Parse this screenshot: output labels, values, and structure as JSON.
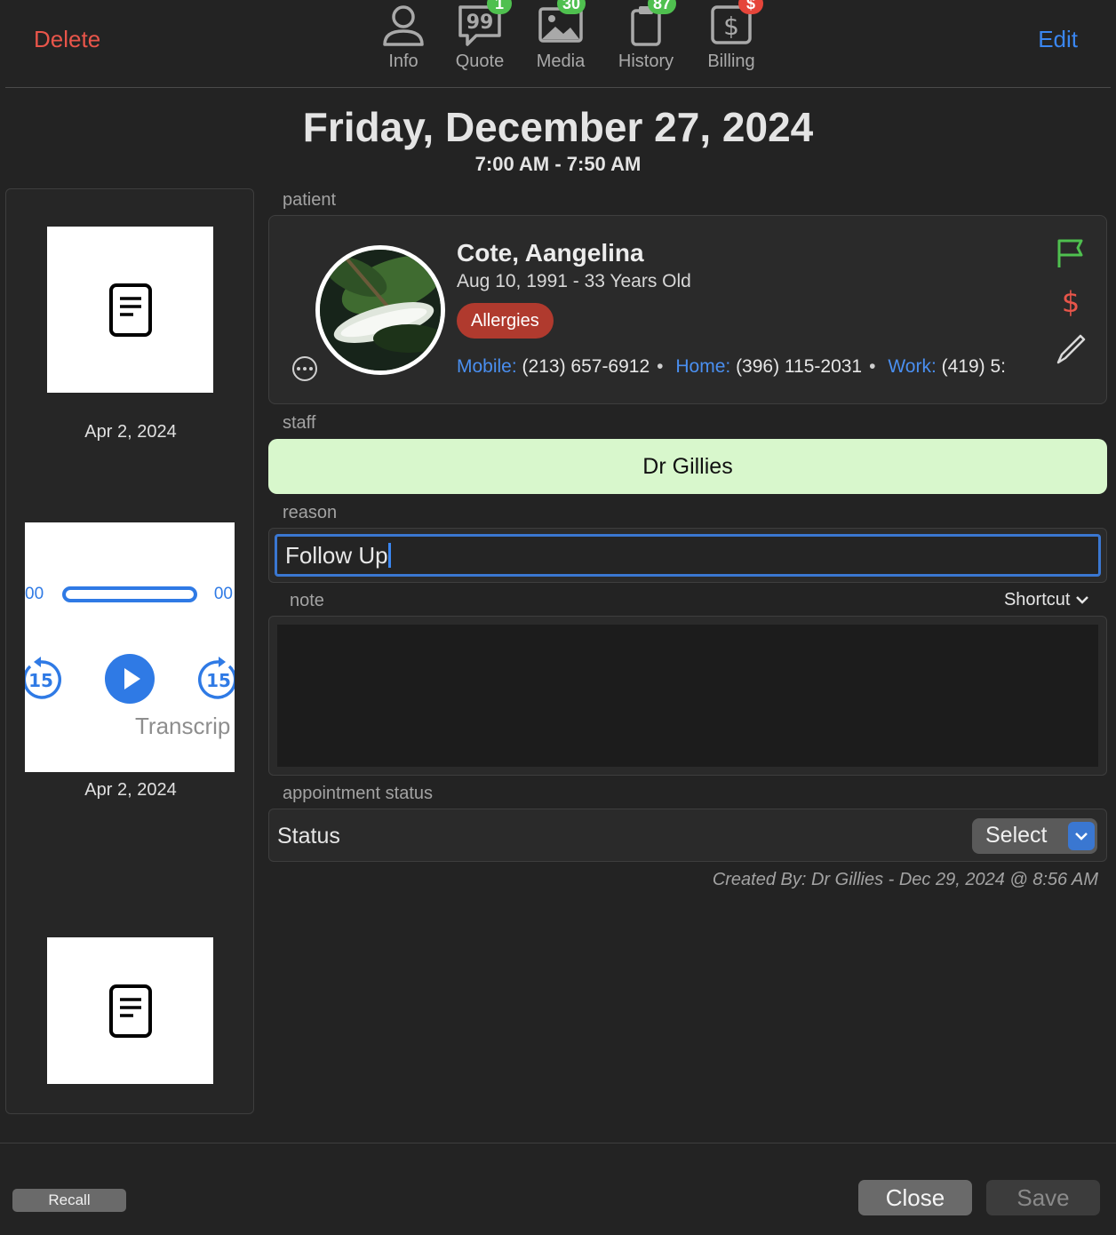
{
  "toolbar": {
    "delete_label": "Delete",
    "edit_label": "Edit",
    "tabs": [
      {
        "label": "Info",
        "icon": "person-icon",
        "badge": ""
      },
      {
        "label": "Quote",
        "icon": "quote-bubble-icon",
        "badge": "1"
      },
      {
        "label": "Media",
        "icon": "photo-icon",
        "badge": "30"
      },
      {
        "label": "History",
        "icon": "clipboard-icon",
        "badge": "87"
      },
      {
        "label": "Billing",
        "icon": "dollar-icon",
        "badge": "$"
      }
    ]
  },
  "appointment": {
    "date": "Friday, December 27, 2024",
    "time": "7:00 AM - 7:50 AM"
  },
  "media_list": [
    {
      "type": "document",
      "icon": "document-icon",
      "date": "Apr 2, 2024"
    },
    {
      "type": "audio",
      "date": "Apr 2, 2024",
      "start_time": "00",
      "end_time": "00",
      "skip_back": "15",
      "skip_forward": "15",
      "transcript_label": "Transcrip"
    },
    {
      "type": "document",
      "icon": "document-icon",
      "date": ""
    }
  ],
  "sections": {
    "patient": "patient",
    "staff": "staff",
    "reason": "reason",
    "note": "note",
    "appointment_status": "appointment status"
  },
  "patient": {
    "name": "Cote, Aangelina",
    "dob_age": "Aug 10, 1991 - 33 Years Old",
    "allergies_label": "Allergies",
    "mobile_label": "Mobile:",
    "mobile": "(213) 657-6912",
    "home_label": "Home:",
    "home": "(396) 115-2031",
    "work_label": "Work:",
    "work": "(419) 5:"
  },
  "staff": {
    "name": "Dr Gillies",
    "color": "#d8f7cc"
  },
  "reason": {
    "value": "Follow Up"
  },
  "note": {
    "shortcut_label": "Shortcut",
    "value": ""
  },
  "status": {
    "label": "Status",
    "select_label": "Select"
  },
  "created_by": "Created By: Dr Gillies - Dec 29, 2024 @ 8:56 AM",
  "footer": {
    "recall_label": "Recall",
    "close_label": "Close",
    "save_label": "Save"
  },
  "colors": {
    "accent": "#3a86f0",
    "danger": "#e8554a",
    "flag": "#4fc04f",
    "badge_green": "#4fc04f",
    "badge_red": "#e5453a"
  }
}
